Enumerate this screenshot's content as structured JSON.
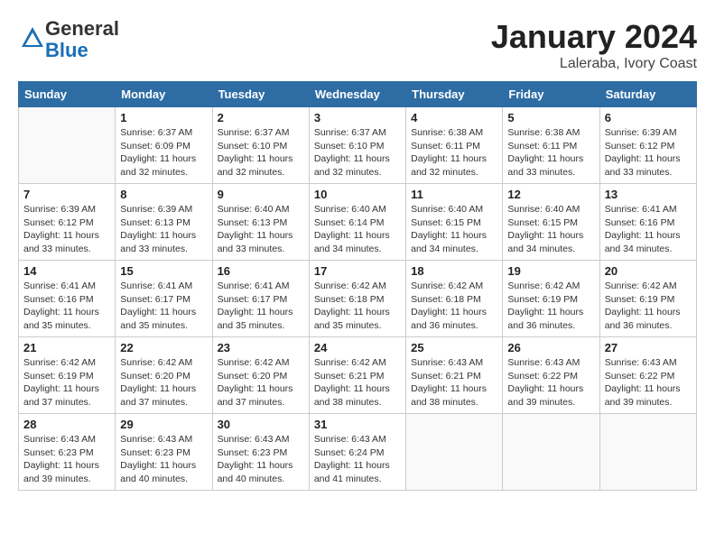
{
  "logo": {
    "general": "General",
    "blue": "Blue"
  },
  "title": {
    "month": "January 2024",
    "location": "Laleraba, Ivory Coast"
  },
  "header": {
    "days": [
      "Sunday",
      "Monday",
      "Tuesday",
      "Wednesday",
      "Thursday",
      "Friday",
      "Saturday"
    ]
  },
  "weeks": [
    [
      {
        "day": null
      },
      {
        "day": "1",
        "sunrise": "Sunrise: 6:37 AM",
        "sunset": "Sunset: 6:09 PM",
        "daylight": "Daylight: 11 hours and 32 minutes."
      },
      {
        "day": "2",
        "sunrise": "Sunrise: 6:37 AM",
        "sunset": "Sunset: 6:10 PM",
        "daylight": "Daylight: 11 hours and 32 minutes."
      },
      {
        "day": "3",
        "sunrise": "Sunrise: 6:37 AM",
        "sunset": "Sunset: 6:10 PM",
        "daylight": "Daylight: 11 hours and 32 minutes."
      },
      {
        "day": "4",
        "sunrise": "Sunrise: 6:38 AM",
        "sunset": "Sunset: 6:11 PM",
        "daylight": "Daylight: 11 hours and 32 minutes."
      },
      {
        "day": "5",
        "sunrise": "Sunrise: 6:38 AM",
        "sunset": "Sunset: 6:11 PM",
        "daylight": "Daylight: 11 hours and 33 minutes."
      },
      {
        "day": "6",
        "sunrise": "Sunrise: 6:39 AM",
        "sunset": "Sunset: 6:12 PM",
        "daylight": "Daylight: 11 hours and 33 minutes."
      }
    ],
    [
      {
        "day": "7",
        "sunrise": "Sunrise: 6:39 AM",
        "sunset": "Sunset: 6:12 PM",
        "daylight": "Daylight: 11 hours and 33 minutes."
      },
      {
        "day": "8",
        "sunrise": "Sunrise: 6:39 AM",
        "sunset": "Sunset: 6:13 PM",
        "daylight": "Daylight: 11 hours and 33 minutes."
      },
      {
        "day": "9",
        "sunrise": "Sunrise: 6:40 AM",
        "sunset": "Sunset: 6:13 PM",
        "daylight": "Daylight: 11 hours and 33 minutes."
      },
      {
        "day": "10",
        "sunrise": "Sunrise: 6:40 AM",
        "sunset": "Sunset: 6:14 PM",
        "daylight": "Daylight: 11 hours and 34 minutes."
      },
      {
        "day": "11",
        "sunrise": "Sunrise: 6:40 AM",
        "sunset": "Sunset: 6:15 PM",
        "daylight": "Daylight: 11 hours and 34 minutes."
      },
      {
        "day": "12",
        "sunrise": "Sunrise: 6:40 AM",
        "sunset": "Sunset: 6:15 PM",
        "daylight": "Daylight: 11 hours and 34 minutes."
      },
      {
        "day": "13",
        "sunrise": "Sunrise: 6:41 AM",
        "sunset": "Sunset: 6:16 PM",
        "daylight": "Daylight: 11 hours and 34 minutes."
      }
    ],
    [
      {
        "day": "14",
        "sunrise": "Sunrise: 6:41 AM",
        "sunset": "Sunset: 6:16 PM",
        "daylight": "Daylight: 11 hours and 35 minutes."
      },
      {
        "day": "15",
        "sunrise": "Sunrise: 6:41 AM",
        "sunset": "Sunset: 6:17 PM",
        "daylight": "Daylight: 11 hours and 35 minutes."
      },
      {
        "day": "16",
        "sunrise": "Sunrise: 6:41 AM",
        "sunset": "Sunset: 6:17 PM",
        "daylight": "Daylight: 11 hours and 35 minutes."
      },
      {
        "day": "17",
        "sunrise": "Sunrise: 6:42 AM",
        "sunset": "Sunset: 6:18 PM",
        "daylight": "Daylight: 11 hours and 35 minutes."
      },
      {
        "day": "18",
        "sunrise": "Sunrise: 6:42 AM",
        "sunset": "Sunset: 6:18 PM",
        "daylight": "Daylight: 11 hours and 36 minutes."
      },
      {
        "day": "19",
        "sunrise": "Sunrise: 6:42 AM",
        "sunset": "Sunset: 6:19 PM",
        "daylight": "Daylight: 11 hours and 36 minutes."
      },
      {
        "day": "20",
        "sunrise": "Sunrise: 6:42 AM",
        "sunset": "Sunset: 6:19 PM",
        "daylight": "Daylight: 11 hours and 36 minutes."
      }
    ],
    [
      {
        "day": "21",
        "sunrise": "Sunrise: 6:42 AM",
        "sunset": "Sunset: 6:19 PM",
        "daylight": "Daylight: 11 hours and 37 minutes."
      },
      {
        "day": "22",
        "sunrise": "Sunrise: 6:42 AM",
        "sunset": "Sunset: 6:20 PM",
        "daylight": "Daylight: 11 hours and 37 minutes."
      },
      {
        "day": "23",
        "sunrise": "Sunrise: 6:42 AM",
        "sunset": "Sunset: 6:20 PM",
        "daylight": "Daylight: 11 hours and 37 minutes."
      },
      {
        "day": "24",
        "sunrise": "Sunrise: 6:42 AM",
        "sunset": "Sunset: 6:21 PM",
        "daylight": "Daylight: 11 hours and 38 minutes."
      },
      {
        "day": "25",
        "sunrise": "Sunrise: 6:43 AM",
        "sunset": "Sunset: 6:21 PM",
        "daylight": "Daylight: 11 hours and 38 minutes."
      },
      {
        "day": "26",
        "sunrise": "Sunrise: 6:43 AM",
        "sunset": "Sunset: 6:22 PM",
        "daylight": "Daylight: 11 hours and 39 minutes."
      },
      {
        "day": "27",
        "sunrise": "Sunrise: 6:43 AM",
        "sunset": "Sunset: 6:22 PM",
        "daylight": "Daylight: 11 hours and 39 minutes."
      }
    ],
    [
      {
        "day": "28",
        "sunrise": "Sunrise: 6:43 AM",
        "sunset": "Sunset: 6:23 PM",
        "daylight": "Daylight: 11 hours and 39 minutes."
      },
      {
        "day": "29",
        "sunrise": "Sunrise: 6:43 AM",
        "sunset": "Sunset: 6:23 PM",
        "daylight": "Daylight: 11 hours and 40 minutes."
      },
      {
        "day": "30",
        "sunrise": "Sunrise: 6:43 AM",
        "sunset": "Sunset: 6:23 PM",
        "daylight": "Daylight: 11 hours and 40 minutes."
      },
      {
        "day": "31",
        "sunrise": "Sunrise: 6:43 AM",
        "sunset": "Sunset: 6:24 PM",
        "daylight": "Daylight: 11 hours and 41 minutes."
      },
      {
        "day": null
      },
      {
        "day": null
      },
      {
        "day": null
      }
    ]
  ]
}
